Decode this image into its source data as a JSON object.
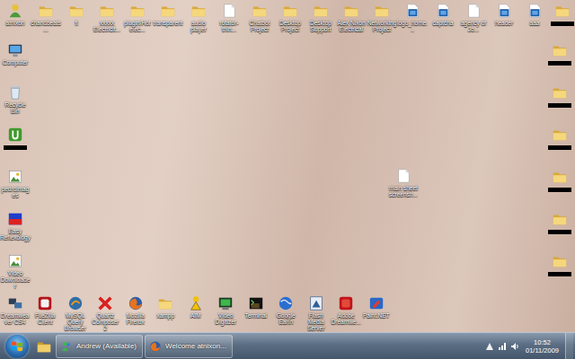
{
  "desktop": {
    "top_row": [
      {
        "label": "atnixon",
        "kind": "user",
        "redacted": false
      },
      {
        "label": "chandbeats...",
        "kind": "folder",
        "redacted": false
      },
      {
        "label": "fi",
        "kind": "folder",
        "redacted": false
      },
      {
        "label": "xxxxx Electricit...",
        "kind": "folder",
        "redacted": false
      },
      {
        "label": "plugin/Hot elec...",
        "kind": "folder",
        "redacted": false
      },
      {
        "label": "transparent",
        "kind": "folder",
        "redacted": false
      },
      {
        "label": "audio player",
        "kind": "folder",
        "redacted": false
      },
      {
        "label": "rotator-thin...",
        "kind": "file",
        "redacted": false
      },
      {
        "label": "Chatbot Project",
        "kind": "folder",
        "redacted": false
      },
      {
        "label": "Desktop Project",
        "kind": "folder",
        "redacted": false
      },
      {
        "label": "Desktop Support",
        "kind": "folder",
        "redacted": false
      },
      {
        "label": "Alex Nixon Electrical",
        "kind": "folder",
        "redacted": false
      },
      {
        "label": "Networking Project",
        "kind": "folder",
        "redacted": false
      },
      {
        "label": "logo_home...",
        "kind": "psd",
        "redacted": false
      },
      {
        "label": "captcha",
        "kind": "psd",
        "redacted": false
      },
      {
        "label": "agency of Jo...",
        "kind": "file",
        "redacted": false
      },
      {
        "label": "header",
        "kind": "psd",
        "redacted": false
      },
      {
        "label": "aaa",
        "kind": "psd",
        "redacted": false
      },
      {
        "label": "",
        "kind": "folder",
        "redacted": true
      }
    ],
    "left_column": [
      {
        "label": "Computer",
        "kind": "computer",
        "redacted": false
      },
      {
        "label": "Recycle Bin",
        "kind": "recycle",
        "redacted": false
      },
      {
        "label": "",
        "kind": "torrent",
        "redacted": true
      },
      {
        "label": "pedroimages",
        "kind": "image",
        "redacted": false
      },
      {
        "label": "Easy Reflexology",
        "kind": "app",
        "redacted": false
      },
      {
        "label": "Video Downloader",
        "kind": "image",
        "redacted": false
      }
    ],
    "right_column": [
      {
        "label": "",
        "kind": "folder",
        "redacted": true
      },
      {
        "label": "",
        "kind": "folder",
        "redacted": true
      },
      {
        "label": "",
        "kind": "folder",
        "redacted": true
      },
      {
        "label": "",
        "kind": "folder",
        "redacted": true
      },
      {
        "label": "",
        "kind": "folder",
        "redacted": true
      },
      {
        "label": "",
        "kind": "folder",
        "redacted": true
      }
    ],
    "floating": [
      {
        "label": "main sheet screensh...",
        "kind": "file",
        "redacted": false
      }
    ],
    "bottom_row": [
      {
        "label": "Dreamweaver CS4",
        "kind": "network",
        "redacted": false
      },
      {
        "label": "FileZilla Client",
        "kind": "filezilla",
        "redacted": false
      },
      {
        "label": "MySQL Query Browser",
        "kind": "mysql",
        "redacted": false
      },
      {
        "label": "Quartz Composer 2",
        "kind": "quartz",
        "redacted": false
      },
      {
        "label": "Mozilla Firefox",
        "kind": "firefox",
        "redacted": false
      },
      {
        "label": "xampp",
        "kind": "folder",
        "redacted": false
      },
      {
        "label": "AIM",
        "kind": "aim",
        "redacted": false
      },
      {
        "label": "Video Digitizer",
        "kind": "video",
        "redacted": false
      },
      {
        "label": "Terminal",
        "kind": "terminal",
        "redacted": false
      },
      {
        "label": "Google Earth",
        "kind": "earth",
        "redacted": false
      },
      {
        "label": "Flash Media Server",
        "kind": "server",
        "redacted": false
      },
      {
        "label": "Adobe Dreamwe...",
        "kind": "flash",
        "redacted": false
      },
      {
        "label": "Paint.NET",
        "kind": "paint",
        "redacted": false
      }
    ]
  },
  "taskbar": {
    "pinned": [
      {
        "kind": "explorer"
      }
    ],
    "tasks": [
      {
        "label": "Andrew (Available)",
        "kind": "msn",
        "selected": false
      },
      {
        "label": "Welcome atnixon...",
        "kind": "firefox",
        "selected": false
      }
    ],
    "tray": {
      "time": "10:52",
      "date": "01/11/2009"
    }
  }
}
